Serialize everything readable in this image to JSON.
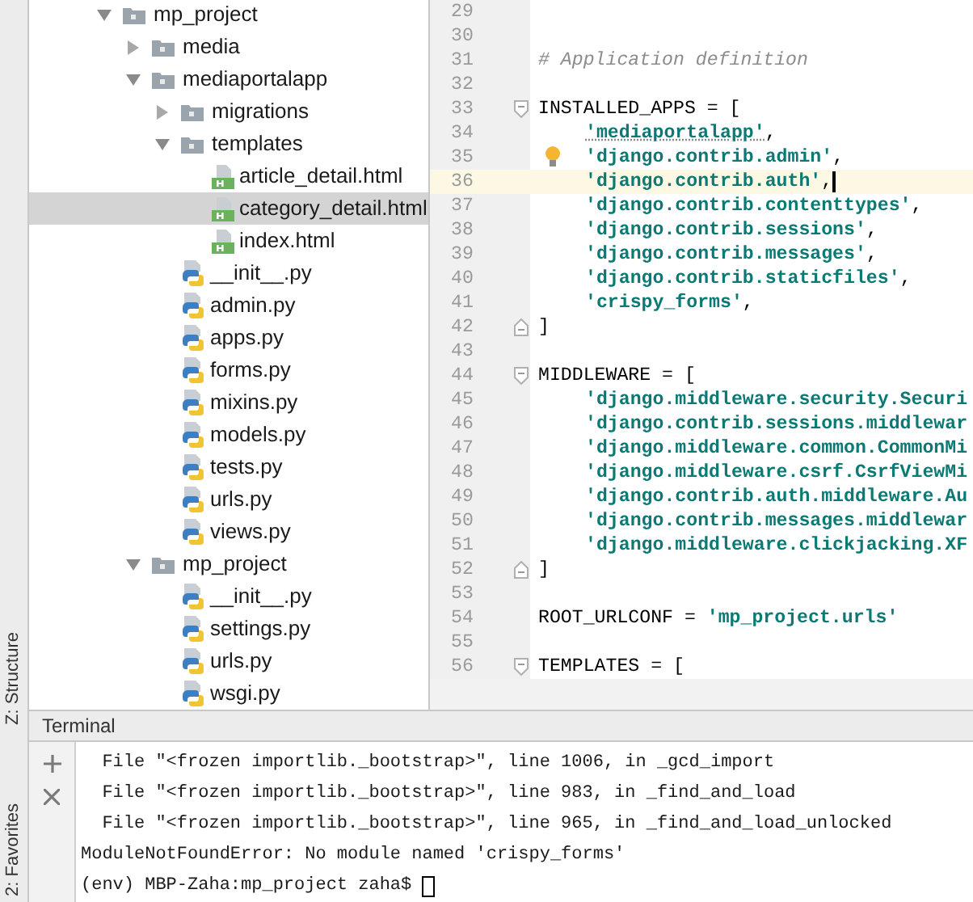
{
  "side_tabs": [
    {
      "label": "Z: Structure"
    },
    {
      "label": "2: Favorites"
    }
  ],
  "tree": [
    {
      "name": "mp_project",
      "kind": "folder",
      "expanded": true,
      "selected": false,
      "children": [
        {
          "name": "media",
          "kind": "folder",
          "expanded": false,
          "selected": false
        },
        {
          "name": "mediaportalapp",
          "kind": "folder",
          "expanded": true,
          "selected": false,
          "children": [
            {
              "name": "migrations",
              "kind": "folder",
              "expanded": false,
              "selected": false
            },
            {
              "name": "templates",
              "kind": "folder",
              "expanded": true,
              "selected": false,
              "children": [
                {
                  "name": "article_detail.html",
                  "kind": "html",
                  "selected": false
                },
                {
                  "name": "category_detail.html",
                  "kind": "html",
                  "selected": true
                },
                {
                  "name": "index.html",
                  "kind": "html",
                  "selected": false
                }
              ]
            },
            {
              "name": "__init__.py",
              "kind": "python",
              "selected": false
            },
            {
              "name": "admin.py",
              "kind": "python",
              "selected": false
            },
            {
              "name": "apps.py",
              "kind": "python",
              "selected": false
            },
            {
              "name": "forms.py",
              "kind": "python",
              "selected": false
            },
            {
              "name": "mixins.py",
              "kind": "python",
              "selected": false
            },
            {
              "name": "models.py",
              "kind": "python",
              "selected": false
            },
            {
              "name": "tests.py",
              "kind": "python",
              "selected": false
            },
            {
              "name": "urls.py",
              "kind": "python",
              "selected": false
            },
            {
              "name": "views.py",
              "kind": "python",
              "selected": false
            }
          ]
        },
        {
          "name": "mp_project",
          "kind": "folder",
          "expanded": true,
          "selected": false,
          "children": [
            {
              "name": "__init__.py",
              "kind": "python",
              "selected": false
            },
            {
              "name": "settings.py",
              "kind": "python",
              "selected": false
            },
            {
              "name": "urls.py",
              "kind": "python",
              "selected": false
            },
            {
              "name": "wsgi.py",
              "kind": "python",
              "selected": false
            }
          ]
        }
      ]
    }
  ],
  "code": [
    {
      "n": "29",
      "current": false,
      "hint": false,
      "fold_open": false,
      "fold_close": false
    },
    {
      "n": "30",
      "current": false,
      "hint": false,
      "fold_open": false,
      "fold_close": false
    },
    {
      "n": "31",
      "current": false,
      "hint": false,
      "fold_open": false,
      "fold_close": false,
      "indented": false,
      "segs": [
        {
          "text": "# Application definition",
          "kind": "comment"
        }
      ]
    },
    {
      "n": "32",
      "current": false,
      "hint": false,
      "fold_open": false,
      "fold_close": false
    },
    {
      "n": "33",
      "current": false,
      "hint": false,
      "fold_open": true,
      "fold_close": false,
      "indented": false,
      "segs": [
        {
          "text": "INSTALLED_APPS = [",
          "kind": "plain"
        }
      ]
    },
    {
      "n": "34",
      "current": false,
      "hint": false,
      "fold_open": false,
      "fold_close": false,
      "indented": true,
      "segs": [
        {
          "text": "'mediaportalapp'",
          "kind": "flagged"
        },
        {
          "text": ",",
          "kind": "plain"
        }
      ]
    },
    {
      "n": "35",
      "current": false,
      "hint": true,
      "fold_open": false,
      "fold_close": false,
      "indented": true,
      "segs": [
        {
          "text": "'django.contrib.admin'",
          "kind": "string"
        },
        {
          "text": ",",
          "kind": "plain"
        }
      ]
    },
    {
      "n": "36",
      "current": true,
      "hint": false,
      "fold_open": false,
      "fold_close": false,
      "indented": true,
      "segs": [
        {
          "text": "'django.contrib.auth'",
          "kind": "string"
        },
        {
          "text": ",",
          "kind": "plain"
        }
      ]
    },
    {
      "n": "37",
      "current": false,
      "hint": false,
      "fold_open": false,
      "fold_close": false,
      "indented": true,
      "segs": [
        {
          "text": "'django.contrib.contenttypes'",
          "kind": "string"
        },
        {
          "text": ",",
          "kind": "plain"
        }
      ]
    },
    {
      "n": "38",
      "current": false,
      "hint": false,
      "fold_open": false,
      "fold_close": false,
      "indented": true,
      "segs": [
        {
          "text": "'django.contrib.sessions'",
          "kind": "string"
        },
        {
          "text": ",",
          "kind": "plain"
        }
      ]
    },
    {
      "n": "39",
      "current": false,
      "hint": false,
      "fold_open": false,
      "fold_close": false,
      "indented": true,
      "segs": [
        {
          "text": "'django.contrib.messages'",
          "kind": "string"
        },
        {
          "text": ",",
          "kind": "plain"
        }
      ]
    },
    {
      "n": "40",
      "current": false,
      "hint": false,
      "fold_open": false,
      "fold_close": false,
      "indented": true,
      "segs": [
        {
          "text": "'django.contrib.staticfiles'",
          "kind": "string"
        },
        {
          "text": ",",
          "kind": "plain"
        }
      ]
    },
    {
      "n": "41",
      "current": false,
      "hint": false,
      "fold_open": false,
      "fold_close": false,
      "indented": true,
      "segs": [
        {
          "text": "'crispy_forms'",
          "kind": "string"
        },
        {
          "text": ",",
          "kind": "plain"
        }
      ]
    },
    {
      "n": "42",
      "current": false,
      "hint": false,
      "fold_open": false,
      "fold_close": true,
      "indented": false,
      "segs": [
        {
          "text": "]",
          "kind": "plain"
        }
      ]
    },
    {
      "n": "43",
      "current": false,
      "hint": false,
      "fold_open": false,
      "fold_close": false
    },
    {
      "n": "44",
      "current": false,
      "hint": false,
      "fold_open": true,
      "fold_close": false,
      "indented": false,
      "segs": [
        {
          "text": "MIDDLEWARE = [",
          "kind": "plain"
        }
      ]
    },
    {
      "n": "45",
      "current": false,
      "hint": false,
      "fold_open": false,
      "fold_close": false,
      "indented": true,
      "segs": [
        {
          "text": "'django.middleware.security.Securi",
          "kind": "string"
        }
      ]
    },
    {
      "n": "46",
      "current": false,
      "hint": false,
      "fold_open": false,
      "fold_close": false,
      "indented": true,
      "segs": [
        {
          "text": "'django.contrib.sessions.middlewar",
          "kind": "string"
        }
      ]
    },
    {
      "n": "47",
      "current": false,
      "hint": false,
      "fold_open": false,
      "fold_close": false,
      "indented": true,
      "segs": [
        {
          "text": "'django.middleware.common.CommonMi",
          "kind": "string"
        }
      ]
    },
    {
      "n": "48",
      "current": false,
      "hint": false,
      "fold_open": false,
      "fold_close": false,
      "indented": true,
      "segs": [
        {
          "text": "'django.middleware.csrf.CsrfViewMi",
          "kind": "string"
        }
      ]
    },
    {
      "n": "49",
      "current": false,
      "hint": false,
      "fold_open": false,
      "fold_close": false,
      "indented": true,
      "segs": [
        {
          "text": "'django.contrib.auth.middleware.Au",
          "kind": "string"
        }
      ]
    },
    {
      "n": "50",
      "current": false,
      "hint": false,
      "fold_open": false,
      "fold_close": false,
      "indented": true,
      "segs": [
        {
          "text": "'django.contrib.messages.middlewar",
          "kind": "string"
        }
      ]
    },
    {
      "n": "51",
      "current": false,
      "hint": false,
      "fold_open": false,
      "fold_close": false,
      "indented": true,
      "segs": [
        {
          "text": "'django.middleware.clickjacking.XF",
          "kind": "string"
        }
      ]
    },
    {
      "n": "52",
      "current": false,
      "hint": false,
      "fold_open": false,
      "fold_close": true,
      "indented": false,
      "segs": [
        {
          "text": "]",
          "kind": "plain"
        }
      ]
    },
    {
      "n": "53",
      "current": false,
      "hint": false,
      "fold_open": false,
      "fold_close": false
    },
    {
      "n": "54",
      "current": false,
      "hint": false,
      "fold_open": false,
      "fold_close": false,
      "indented": false,
      "segs": [
        {
          "text": "ROOT_URLCONF = ",
          "kind": "plain"
        },
        {
          "text": "'mp_project.urls'",
          "kind": "string"
        }
      ]
    },
    {
      "n": "55",
      "current": false,
      "hint": false,
      "fold_open": false,
      "fold_close": false
    },
    {
      "n": "56",
      "current": false,
      "hint": false,
      "fold_open": true,
      "fold_close": false,
      "indented": false,
      "segs": [
        {
          "text": "TEMPLATES = [",
          "kind": "plain"
        }
      ]
    }
  ],
  "terminal": {
    "title": "Terminal",
    "lines": [
      "  File \"<frozen importlib._bootstrap>\", line 1006, in _gcd_import",
      "  File \"<frozen importlib._bootstrap>\", line 983, in _find_and_load",
      "  File \"<frozen importlib._bootstrap>\", line 965, in _find_and_load_unlocked",
      "ModuleNotFoundError: No module named 'crispy_forms'"
    ],
    "prompt": "(env) MBP-Zaha:mp_project zaha$"
  }
}
